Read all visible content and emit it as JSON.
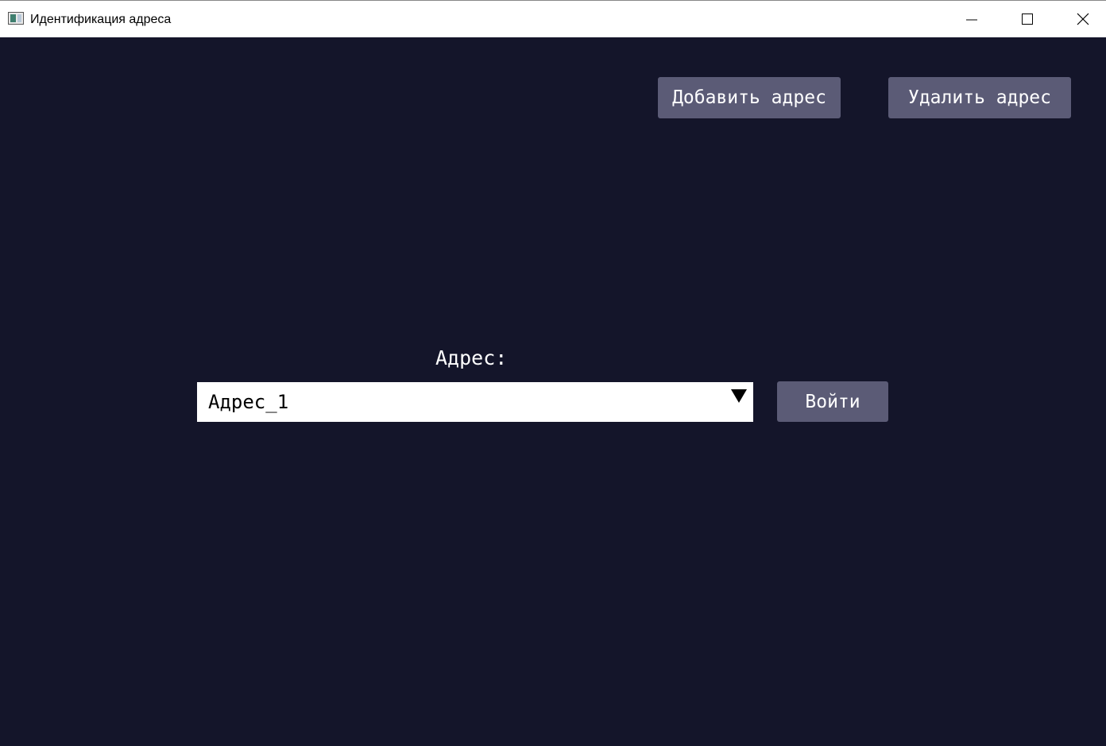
{
  "window": {
    "title": "Идентификация адреса",
    "controls": {
      "minimize_icon": "minimize-icon",
      "maximize_icon": "maximize-icon",
      "close_icon": "close-icon"
    }
  },
  "toolbar": {
    "add_label": "Добавить адрес",
    "delete_label": "Удалить адрес"
  },
  "form": {
    "address_label": "Адрес:",
    "address_selected": "Адрес_1",
    "login_label": "Войти"
  },
  "colors": {
    "background": "#14152a",
    "button": "#5b5b76",
    "button_text": "#ffffff",
    "combo_background": "#ffffff"
  }
}
